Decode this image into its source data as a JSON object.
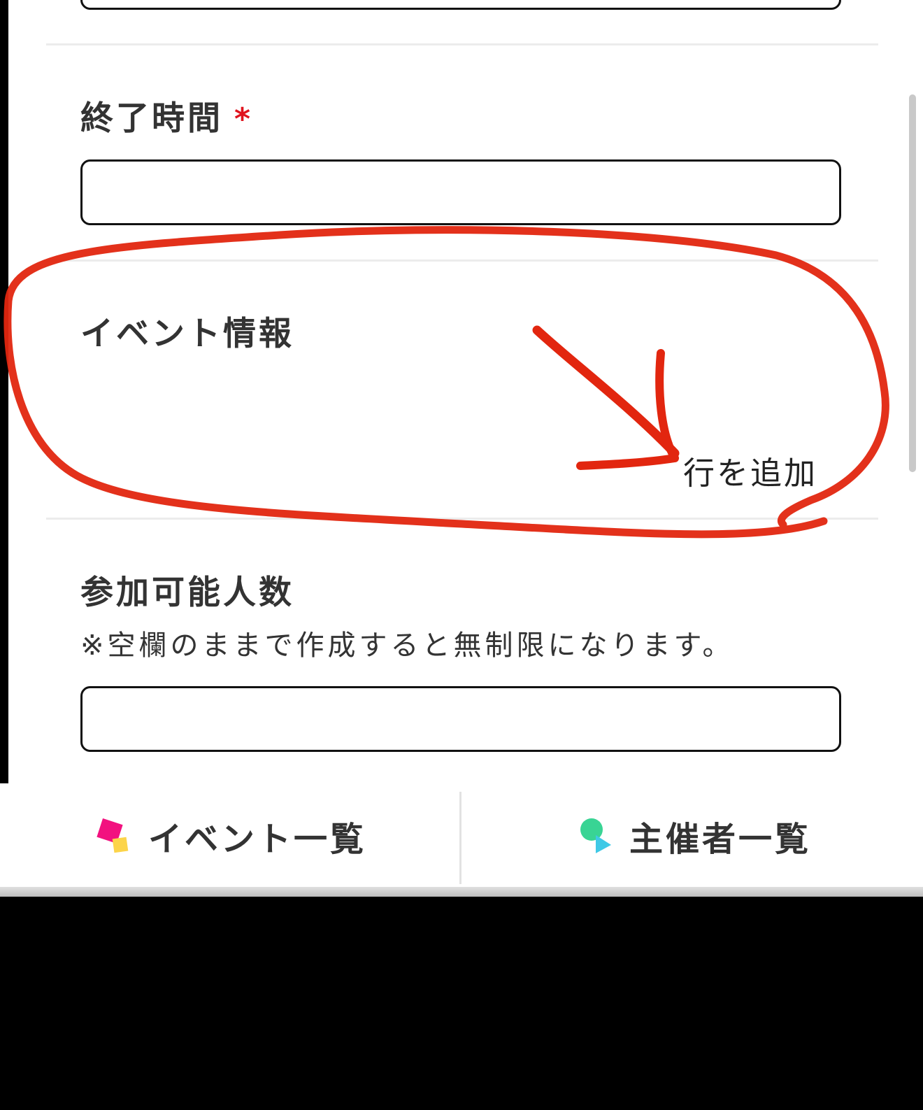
{
  "form": {
    "end_time": {
      "label": "終了時間",
      "required_mark": "*",
      "value": ""
    },
    "event_info": {
      "label": "イベント情報",
      "add_row_label": "行を追加"
    },
    "capacity": {
      "label": "参加可能人数",
      "note": "※空欄のままで作成すると無制限になります。",
      "value": ""
    }
  },
  "bottom_nav": {
    "items": [
      {
        "label": "イベント一覧",
        "icon": "event-list-icon"
      },
      {
        "label": "主催者一覧",
        "icon": "organizer-list-icon"
      }
    ]
  },
  "colors": {
    "required": "#e0141e",
    "annotation": "#e2260f",
    "event_icon_pink": "#f2117f",
    "event_icon_yellow": "#fcd44a",
    "organizer_icon_green": "#39d494",
    "organizer_icon_cyan": "#3fc9e6"
  }
}
